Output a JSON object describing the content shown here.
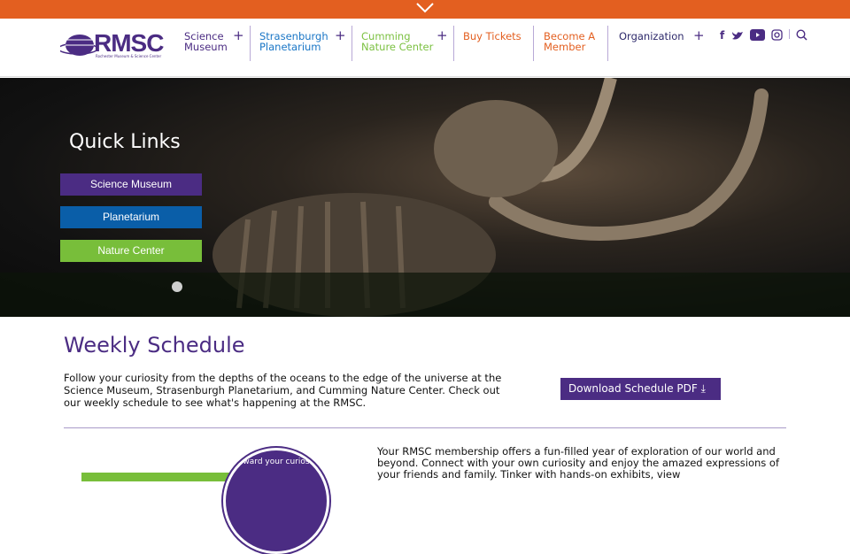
{
  "logo": {
    "text": "RMSC",
    "subtitle": "Rochester Museum & Science Center"
  },
  "nav": [
    {
      "label_line1": "Science",
      "label_line2": "Museum",
      "color": "#4b2c83",
      "expandable": true
    },
    {
      "label_line1": "Strasenburgh",
      "label_line2": "Planetarium",
      "color": "#1a76c6",
      "expandable": true
    },
    {
      "label_line1": "Cumming",
      "label_line2": "Nature Center",
      "color": "#7cc142",
      "expandable": true
    },
    {
      "label_line1": "Buy Tickets",
      "label_line2": "",
      "color": "#e35f20",
      "expandable": false
    },
    {
      "label_line1": "Become A",
      "label_line2": "Member",
      "color": "#e35f20",
      "expandable": false
    },
    {
      "label_line1": "Organization",
      "label_line2": "",
      "color": "#2e2a6b",
      "expandable": true
    }
  ],
  "plus": "+",
  "social": {
    "facebook": "f",
    "twitter": "twitter-icon",
    "youtube": "youtube-icon",
    "instagram": "instagram-icon",
    "search": "search-icon"
  },
  "quick_links": {
    "title": "Quick Links",
    "buttons": [
      {
        "label": "Science Museum",
        "color": "#4b2c83"
      },
      {
        "label": "Planetarium",
        "color": "#0a5ea8"
      },
      {
        "label": "Nature Center",
        "color": "#78be3a"
      }
    ]
  },
  "schedule": {
    "title": "Weekly Schedule",
    "intro": "Follow your curiosity from the depths of the oceans to the edge of the universe at the Science Museum, Strasenburgh Planetarium, and Cumming Nature Center. Check out our weekly schedule to see what's happening at the RMSC.",
    "download_label": "Download Schedule PDF",
    "download_icon": "⤓"
  },
  "membership": {
    "text": "Your RMSC membership offers a fun-filled year of exploration of our world and beyond. Connect with your own curiosity and enjoy the amazed expressions of your friends and family. Tinker with hands-on exhibits, view",
    "badge_text": "ward your curios"
  }
}
